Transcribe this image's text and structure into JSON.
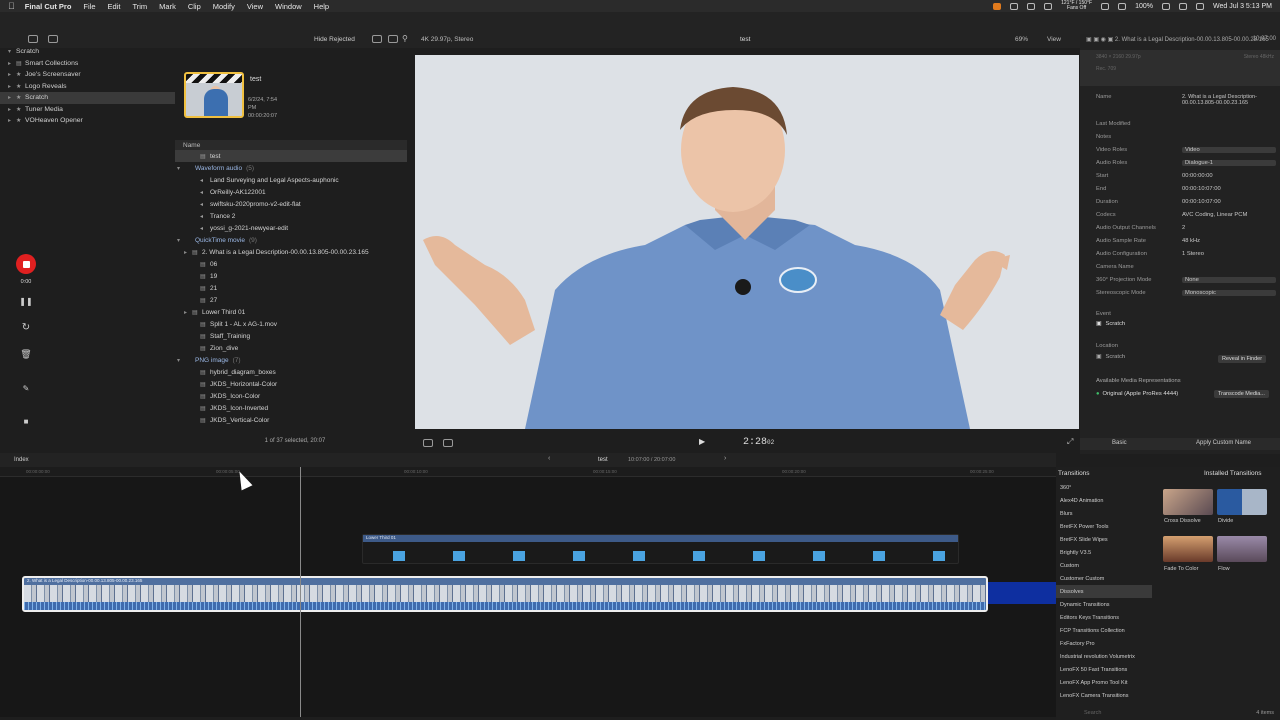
{
  "menubar": {
    "app_name": "Final Cut Pro",
    "items": [
      "File",
      "Edit",
      "Trim",
      "Mark",
      "Clip",
      "Modify",
      "View",
      "Window",
      "Help"
    ],
    "weather": "121°F / 150°F",
    "weather_sub": "Fans Off",
    "battery": "100%",
    "datetime": "Wed Jul 3  5:13 PM"
  },
  "libraries": {
    "title": "Scratch",
    "items": [
      {
        "label": "Smart Collections"
      },
      {
        "label": "Joe's Screensaver"
      },
      {
        "label": "Logo Reveals"
      },
      {
        "label": "Scratch",
        "selected": true
      },
      {
        "label": "Tuner Media"
      },
      {
        "label": "VOHeaven Opener"
      }
    ]
  },
  "browser": {
    "hide_rejected": "Hide Rejected",
    "thumb_title": "test",
    "thumb_date": "6/2/24, 7:54 PM",
    "thumb_duration": "00:00:20:07",
    "column_name": "Name",
    "rows": [
      {
        "label": "test",
        "indent": 1,
        "selected": true
      },
      {
        "label": "Waveform audio",
        "count": "(5)",
        "group": true
      },
      {
        "label": "Land Surveying and Legal Aspects-auphonic",
        "indent": 2
      },
      {
        "label": "OrReilly-AK122001",
        "indent": 2
      },
      {
        "label": "swiftsku-2020promo-v2-edit-flat",
        "indent": 2
      },
      {
        "label": "Trance 2",
        "indent": 2
      },
      {
        "label": "yossi_g-2021-newyear-edit",
        "indent": 2
      },
      {
        "label": "QuickTime movie",
        "count": "(9)",
        "group": true
      },
      {
        "label": "2. What is a Legal Description-00.00.13.805-00.00.23.165",
        "indent": 2,
        "expand": true
      },
      {
        "label": "06",
        "indent": 2
      },
      {
        "label": "19",
        "indent": 2
      },
      {
        "label": "21",
        "indent": 2
      },
      {
        "label": "27",
        "indent": 2
      },
      {
        "label": "Lower Third 01",
        "indent": 2,
        "expand": true
      },
      {
        "label": "Split 1 - AL x AG-1.mov",
        "indent": 2
      },
      {
        "label": "Staff_Training",
        "indent": 2
      },
      {
        "label": "Zion_dive",
        "indent": 2
      },
      {
        "label": "PNG image",
        "count": "(7)",
        "group": true
      },
      {
        "label": "hybrid_diagram_boxes",
        "indent": 2
      },
      {
        "label": "JKDS_Horizontal-Color",
        "indent": 2
      },
      {
        "label": "JKDS_Icon-Color",
        "indent": 2
      },
      {
        "label": "JKDS_Icon-Inverted",
        "indent": 2
      },
      {
        "label": "JKDS_Vertical-Color",
        "indent": 2
      }
    ],
    "footer": "1 of 37 selected, 20:07"
  },
  "recorder": {
    "timer": "0:00"
  },
  "viewer": {
    "format": "4K 29.97p, Stereo",
    "title": "test",
    "zoom": "69%",
    "view_label": "View",
    "timecode": "2:28",
    "timecode_suffix": "02"
  },
  "inspector": {
    "header_title": "2. What is a Legal Description-00.00.13.805-00.00.23.165",
    "header_time": "10:07:00",
    "res": "3840 × 2160 29.97p",
    "audio": "Stereo 48kHz",
    "rec": "Rec. 709",
    "fields": [
      {
        "k": "Name",
        "v": "2. What is a Legal Description-00.00.13.805-00.00.23.165"
      },
      {
        "k": "Last Modified",
        "v": ""
      },
      {
        "k": "Notes",
        "v": ""
      },
      {
        "k": "Video Roles",
        "v": "Video"
      },
      {
        "k": "Audio Roles",
        "v": "Dialogue-1"
      },
      {
        "k": "Start",
        "v": "00:00:00:00"
      },
      {
        "k": "End",
        "v": "00:00:10:07:00"
      },
      {
        "k": "Duration",
        "v": "00:00:10:07:00"
      },
      {
        "k": "Codecs",
        "v": "AVC Coding, Linear PCM"
      },
      {
        "k": "Audio Output Channels",
        "v": "2"
      },
      {
        "k": "Audio Sample Rate",
        "v": "48 kHz"
      },
      {
        "k": "Audio Configuration",
        "v": "1 Stereo"
      },
      {
        "k": "Camera Name",
        "v": ""
      },
      {
        "k": "360° Projection Mode",
        "v": "None"
      },
      {
        "k": "Stereoscopic Mode",
        "v": "Monoscopic"
      }
    ],
    "event_label": "Event",
    "event_value": "Scratch",
    "location_label": "Location",
    "location_value": "Scratch",
    "reveal": "Reveal in Finder",
    "media_reps": "Available Media Representations",
    "original": "Original (Apple ProRes 4444)",
    "transcode": "Transcode Media...",
    "basic": "Basic",
    "apply_custom": "Apply Custom Name"
  },
  "timeline": {
    "index": "Index",
    "project": "test",
    "project_time": "10:07:00 / 20:07:00",
    "ruler": [
      "00:00:00:00",
      "00:00:05:00",
      "00:00:10:00",
      "00:00:15:00",
      "00:00:20:00",
      "00:00:25:00"
    ],
    "lower_third_label": "Lower Third 01",
    "main_clip_label": "2. What is a Legal Description-00.00.13.805-00.00.23.165"
  },
  "transitions": {
    "title": "Transitions",
    "installed": "Installed Transitions",
    "categories": [
      "360°",
      "Alex4D Animation",
      "Blurs",
      "BretFX Power Tools",
      "BretFX Slide Wipes",
      "Brightly V3.5",
      "Custom",
      "Customer Custom",
      "Dissolves",
      "Dynamic Transitions",
      "Editors Keys Transitions",
      "FCP Transitions Collection",
      "FxFactory Pro",
      "Industrial revolution Volumetrix",
      "LenoFX 50 Fast Transitions",
      "LenoFX App Promo Tool Kit",
      "LenoFX Camera Transitions"
    ],
    "selected": "Dissolves",
    "items": [
      "Cross Dissolve",
      "Divide",
      "Fade To Color",
      "Flow"
    ],
    "count": "4 items",
    "search_placeholder": "Search"
  }
}
